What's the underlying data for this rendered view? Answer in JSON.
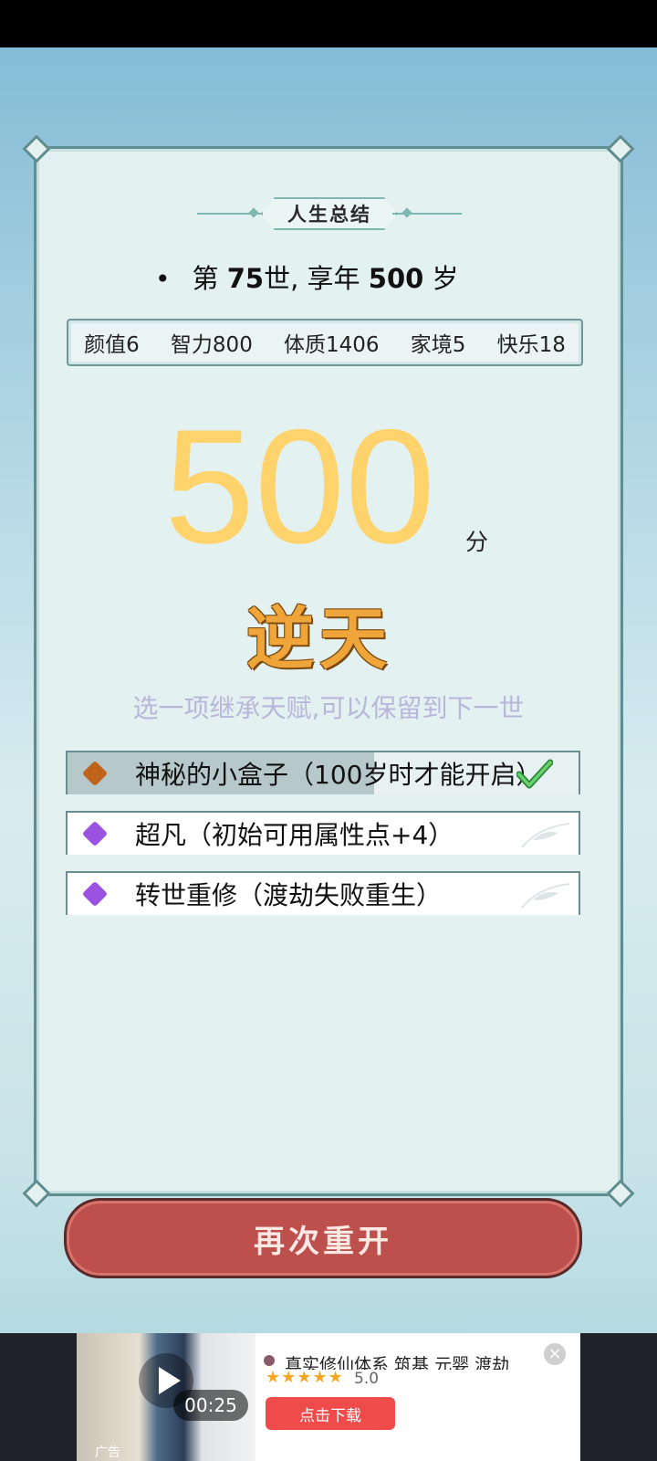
{
  "summary": {
    "title": "人生总结",
    "life_prefix": "第",
    "life_num": "75",
    "life_mid": "世, 享年",
    "age_num": "500",
    "age_suffix": "岁"
  },
  "stats": [
    {
      "label": "颜值6"
    },
    {
      "label": "智力800"
    },
    {
      "label": "体质1406"
    },
    {
      "label": "家境5"
    },
    {
      "label": "快乐18"
    }
  ],
  "score": {
    "value": "500",
    "unit": "分",
    "rank": "逆天"
  },
  "inherit_hint": "选一项继承天赋,可以保留到下一世",
  "talents": [
    {
      "text": "神秘的小盒子（100岁时才能开启）",
      "color": "#c1621a",
      "selected": true
    },
    {
      "text": "超凡（初始可用属性点+4）",
      "color": "#9b52e0",
      "selected": false
    },
    {
      "text": "转世重修（渡劫失败重生）",
      "color": "#9b52e0",
      "selected": false
    }
  ],
  "restart_label": "再次重开",
  "ad": {
    "time": "00:25",
    "tag": "广告",
    "title": "真实修仙体系   筑基   元婴   渡劫",
    "stars": "★★★★★",
    "rating": "5.0",
    "download": "点击下载",
    "close": "×"
  }
}
